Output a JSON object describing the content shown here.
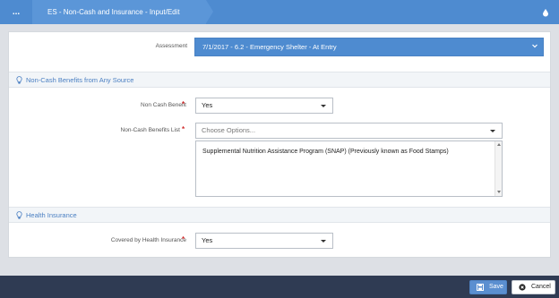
{
  "header": {
    "more_label": "...",
    "title": "ES - Non-Cash and Insurance - Input/Edit",
    "accent": "#4e8bd0"
  },
  "assessment": {
    "label": "Assessment",
    "value": "7/1/2017 - 6.2 - Emergency Shelter - At Entry"
  },
  "sections": {
    "noncash": {
      "title": "Non-Cash Benefits from Any Source"
    },
    "health": {
      "title": "Health Insurance"
    }
  },
  "fields": {
    "non_cash_benefit": {
      "label": "Non Cash Benefit",
      "value": "Yes"
    },
    "non_cash_benefits_list": {
      "label": "Non-Cash Benefits List",
      "placeholder": "Choose Options...",
      "items": [
        "Supplemental Nutrition Assistance Program (SNAP) (Previously known as Food Stamps)"
      ]
    },
    "covered_by_health_insurance": {
      "label": "Covered by Health Insurance",
      "value": "Yes"
    }
  },
  "required_mark": "*",
  "footer": {
    "save_label": "Save",
    "cancel_label": "Cancel"
  },
  "icons": {
    "header_right": "water-drop-icon",
    "section": "lightbulb-icon",
    "save": "floppy-disk-icon",
    "cancel": "close-icon"
  }
}
